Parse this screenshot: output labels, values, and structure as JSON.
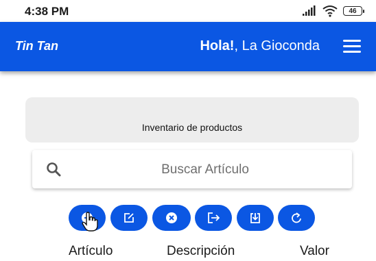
{
  "status_bar": {
    "time": "4:38 PM",
    "battery": "46"
  },
  "app_bar": {
    "brand": "Tin Tan",
    "greeting_hola": "Hola!",
    "greeting_name": ", La Gioconda"
  },
  "inventory": {
    "title": "Inventario de productos"
  },
  "search": {
    "placeholder": "Buscar Artículo"
  },
  "actions": [
    {
      "icon": "add-circle-icon"
    },
    {
      "icon": "edit-icon"
    },
    {
      "icon": "cancel-circle-icon"
    },
    {
      "icon": "logout-icon"
    },
    {
      "icon": "download-icon"
    },
    {
      "icon": "refresh-icon"
    }
  ],
  "labels": {
    "articulo": "Artículo",
    "descripcion": "Descripción",
    "valor": "Valor"
  },
  "colors": {
    "primary": "#0b57e3",
    "card": "#ededed"
  }
}
